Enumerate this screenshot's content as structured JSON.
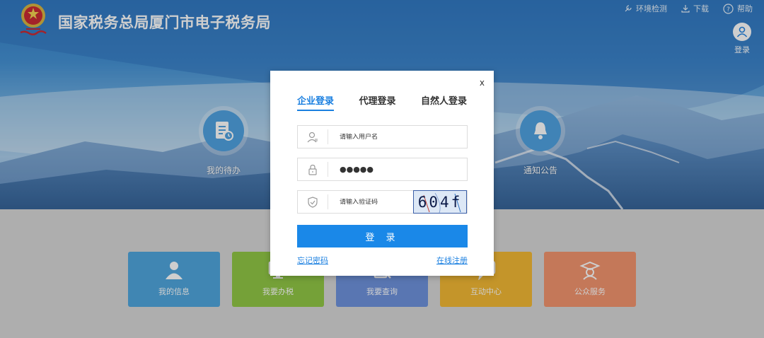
{
  "header": {
    "title": "国家税务总局厦门市电子税务局",
    "links": [
      {
        "label": "环境检测",
        "icon": "wrench-icon"
      },
      {
        "label": "下载",
        "icon": "download-icon"
      },
      {
        "label": "帮助",
        "icon": "help-icon"
      }
    ],
    "user_login_label": "登录"
  },
  "hero": {
    "todo_label": "我的待办",
    "notice_label": "通知公告"
  },
  "tiles": [
    {
      "label": "我的信息",
      "color": "#4aa3dd"
    },
    {
      "label": "我要办税",
      "color": "#8dc63f"
    },
    {
      "label": "我要查询",
      "color": "#6a8fdc"
    },
    {
      "label": "互动中心",
      "color": "#f3b72e"
    },
    {
      "label": "公众服务",
      "color": "#f2916a"
    }
  ],
  "modal": {
    "close_label": "x",
    "tabs": [
      {
        "label": "企业登录",
        "active": true
      },
      {
        "label": "代理登录",
        "active": false
      },
      {
        "label": "自然人登录",
        "active": false
      }
    ],
    "username_placeholder": "请输入用户名",
    "password_value": "●●●●●",
    "captcha_placeholder": "请输入验证码",
    "captcha_text": "604f",
    "login_button": "登 录",
    "forgot_password": "忘记密码",
    "register": "在线注册",
    "accent_color": "#1a88e8"
  }
}
